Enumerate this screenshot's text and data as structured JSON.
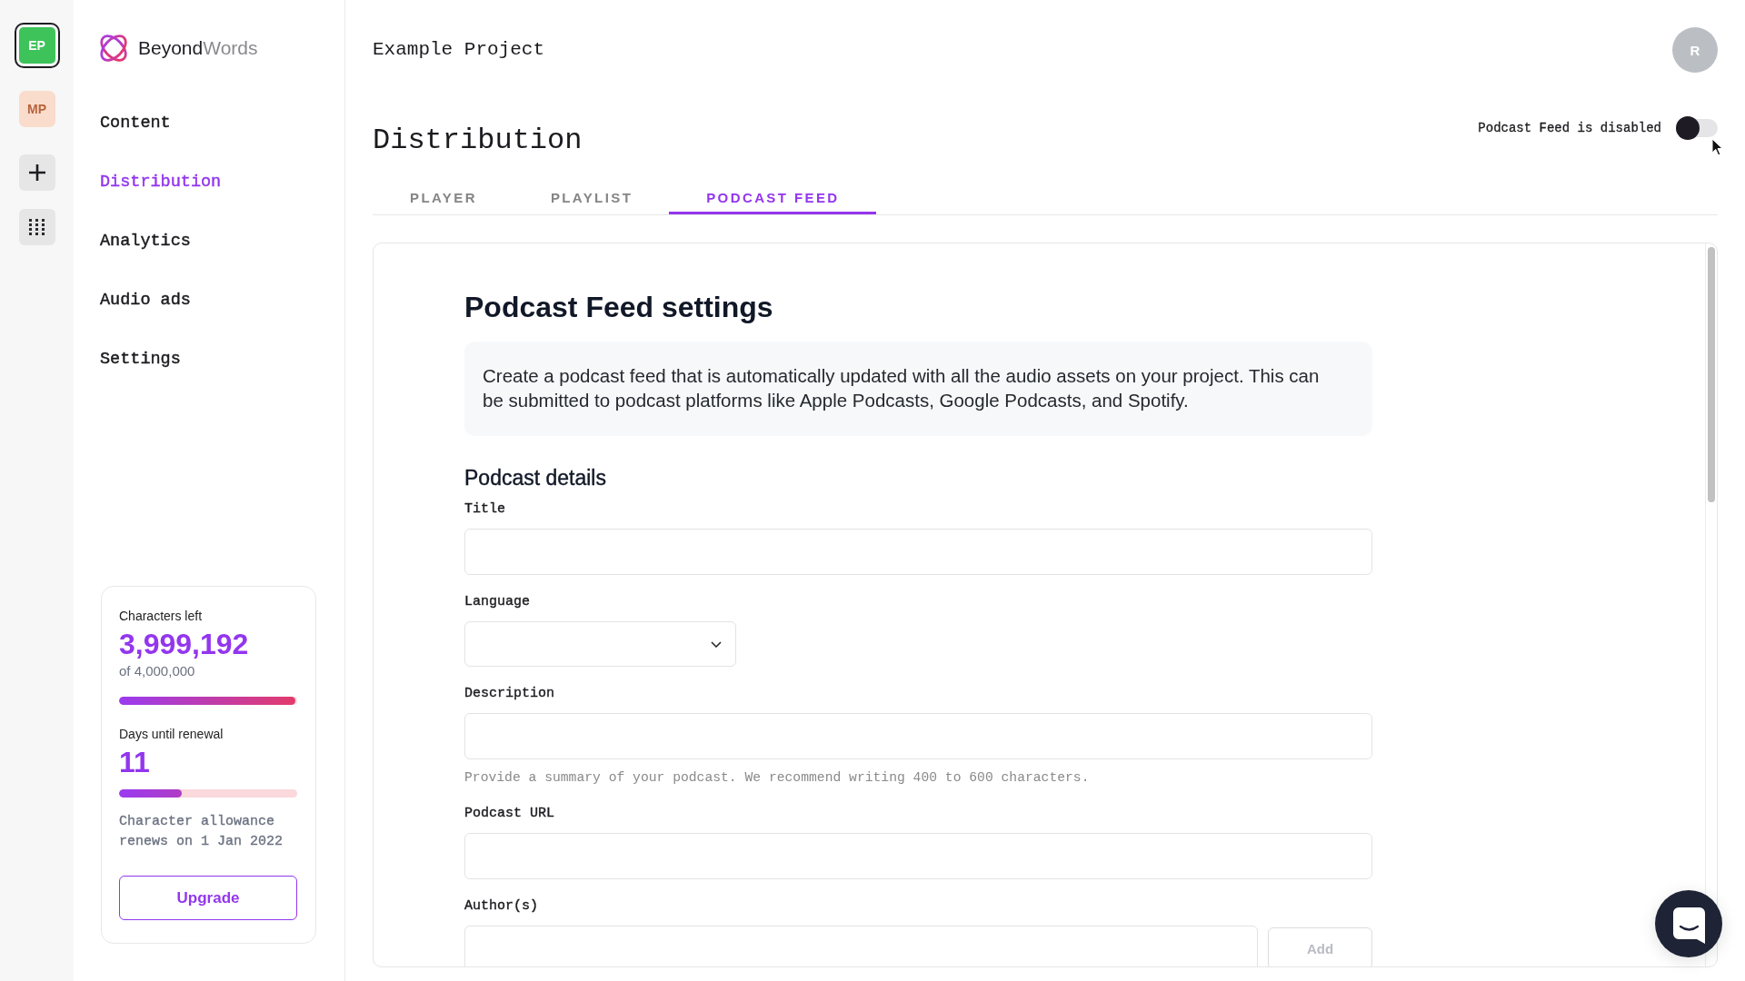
{
  "workspace_rail": {
    "projects": [
      {
        "initials": "EP",
        "color": "#3dc35a",
        "selected": true
      },
      {
        "initials": "MP",
        "color": "#f9dccc",
        "selected": false
      }
    ]
  },
  "brand": {
    "lead": "Beyond",
    "tail": "Words"
  },
  "nav": [
    {
      "label": "Content",
      "selected": false
    },
    {
      "label": "Distribution",
      "selected": true
    },
    {
      "label": "Analytics",
      "selected": false
    },
    {
      "label": "Audio ads",
      "selected": false
    },
    {
      "label": "Settings",
      "selected": false
    }
  ],
  "usage": {
    "characters": {
      "label": "Characters left",
      "value": "3,999,192",
      "total": "of 4,000,000",
      "level": 0.99
    },
    "renewal": {
      "label": "Days until renewal",
      "value": "11",
      "level": 0.35
    },
    "note": "Character allowance renews on 1 Jan 2022",
    "button": "Upgrade"
  },
  "header": {
    "project": "Example Project",
    "avatar": "R"
  },
  "page": {
    "title": "Distribution",
    "feed_toggle": {
      "label": "Podcast Feed is disabled",
      "on": false
    }
  },
  "tabs": [
    {
      "label": "PLAYER",
      "selected": false
    },
    {
      "label": "PLAYLIST",
      "selected": false
    },
    {
      "label": "PODCAST FEED",
      "selected": true
    }
  ],
  "feed_settings": {
    "title": "Podcast Feed settings",
    "intro": "Create a podcast feed that is automatically updated with all the audio assets on your project. This can be submitted to podcast platforms like Apple Podcasts, Google Podcasts, and Spotify.",
    "section": "Podcast details",
    "fields": [
      {
        "kind": "text",
        "label": "Title"
      },
      {
        "kind": "select",
        "label": "Language"
      },
      {
        "kind": "text",
        "label": "Description",
        "hint": "Provide a summary of your podcast. We recommend writing 400 to 600 characters."
      },
      {
        "kind": "text",
        "label": "Podcast URL"
      },
      {
        "kind": "text_button",
        "label": "Author(s)",
        "button": {
          "label": "Add",
          "disabled": true
        }
      }
    ]
  }
}
